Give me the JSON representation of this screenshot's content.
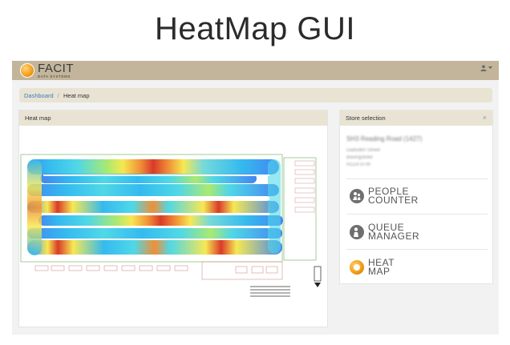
{
  "page": {
    "title": "HeatMap GUI"
  },
  "topbar": {
    "logo": {
      "main": "FACIT",
      "sub": "DATA SYSTEMS"
    },
    "user_icon": "user-icon"
  },
  "breadcrumb": {
    "home": "Dashboard",
    "current": "Heat map"
  },
  "heatmap_panel": {
    "title": "Heat map"
  },
  "store_panel": {
    "title": "Store selection",
    "close_glyph": "×",
    "store_name": "SH3 Reading Road (1427)",
    "address_lines": [
      "Gadsden Street",
      "Basingstoke",
      "RG24 8TW"
    ]
  },
  "apps": [
    {
      "line1": "PEOPLE",
      "line2": "COUNTER",
      "icon": "people-counter-icon"
    },
    {
      "line1": "QUEUE",
      "line2": "MANAGER",
      "icon": "queue-manager-icon"
    },
    {
      "line1": "HEAT",
      "line2": "MAP",
      "icon": "heat-map-icon"
    }
  ],
  "colors": {
    "topbar": "#c2b59b",
    "breadcrumb_bg": "#e9e3d4",
    "link": "#3c7cc0",
    "heat_high": "#d22b1f",
    "heat_mid": "#f2e84a",
    "heat_low": "#3aa0f2"
  }
}
